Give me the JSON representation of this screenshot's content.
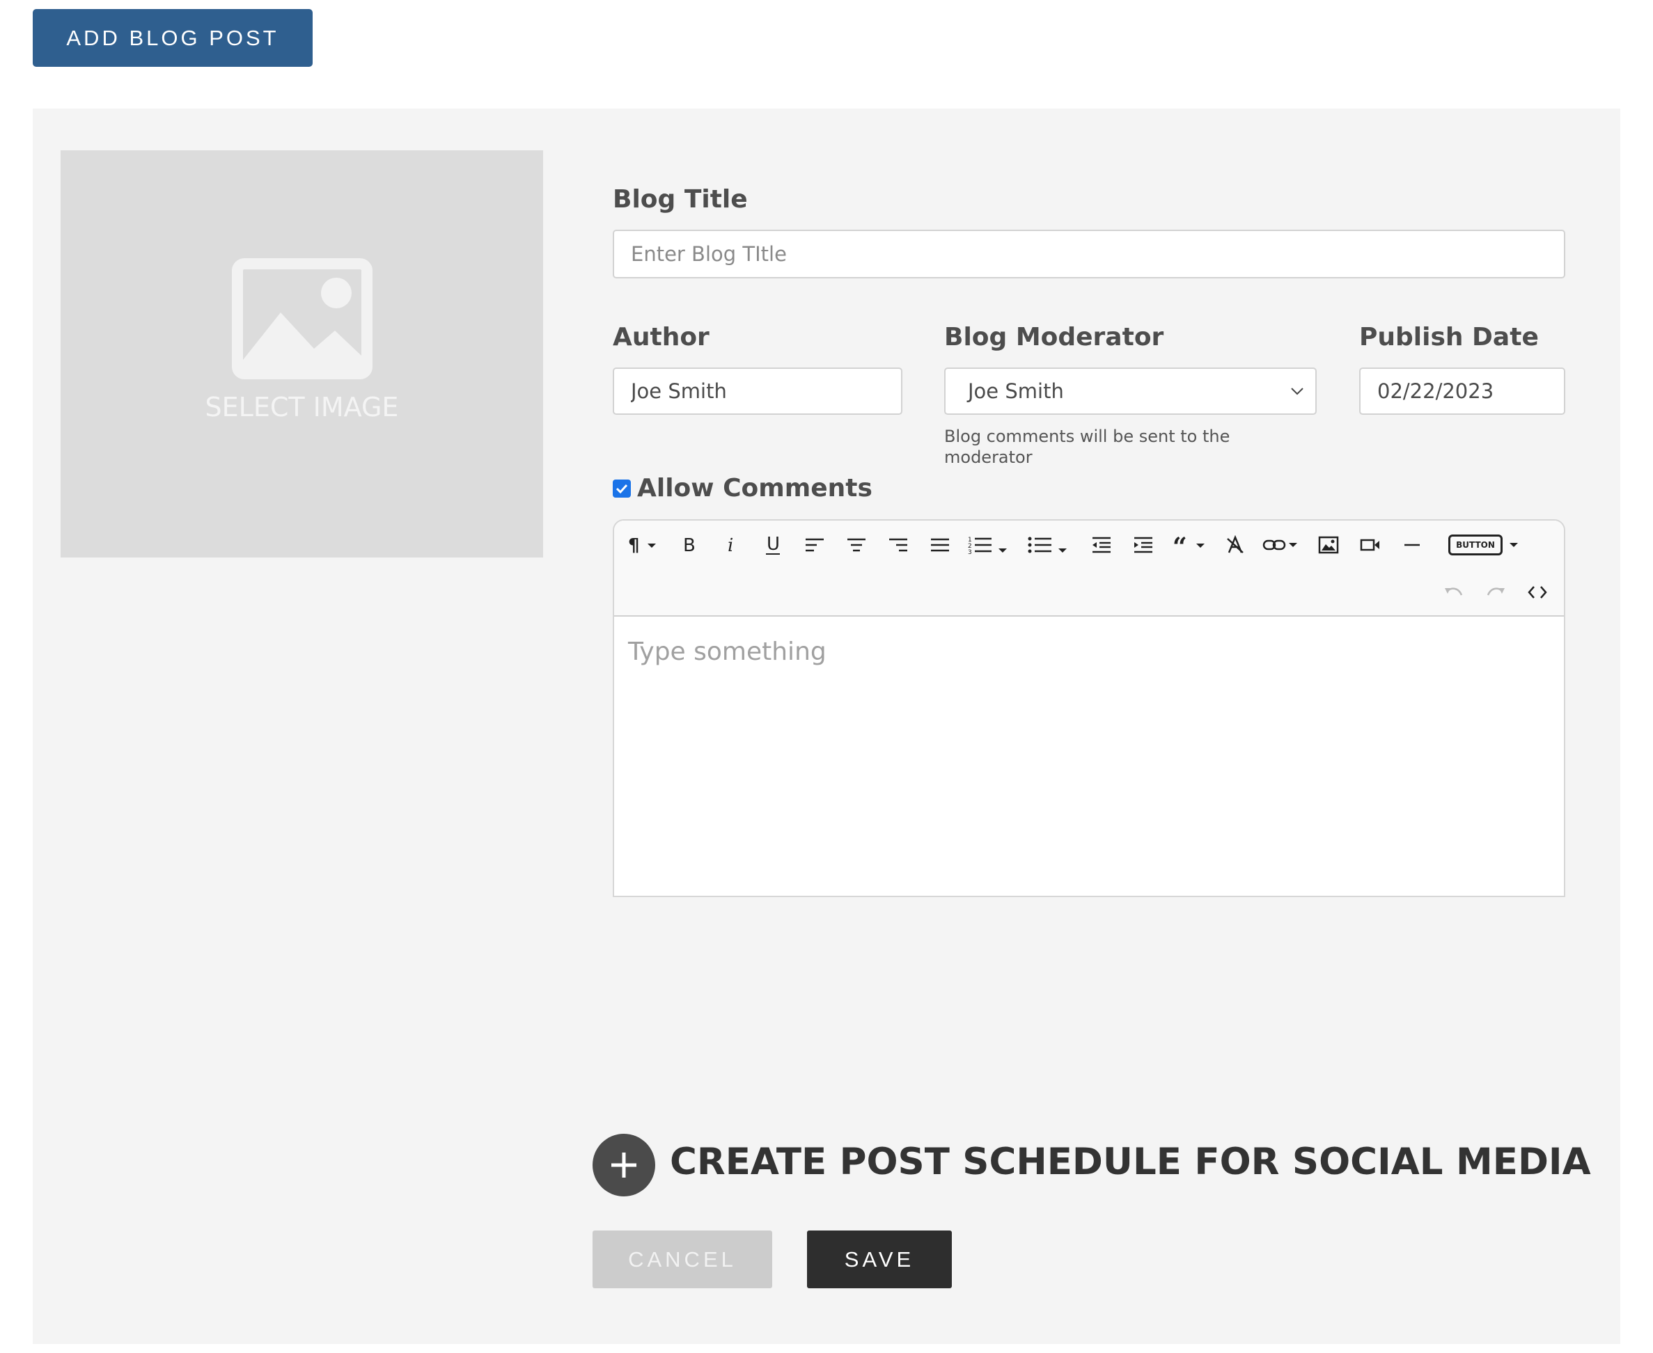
{
  "header": {
    "add_button_label": "ADD BLOG POST"
  },
  "image_picker": {
    "label": "SELECT IMAGE",
    "icon": "image-icon"
  },
  "form": {
    "title_label": "Blog Title",
    "title_placeholder": "Enter Blog TItle",
    "title_value": "",
    "author_label": "Author",
    "author_value": "Joe Smith",
    "moderator_label": "Blog Moderator",
    "moderator_value": "Joe Smith",
    "moderator_hint_line1": "Blog comments will be sent to the",
    "moderator_hint_line2": "moderator",
    "publish_label": "Publish Date",
    "publish_value": "02/22/2023",
    "allow_comments_label": "Allow Comments",
    "allow_comments_checked": true
  },
  "editor": {
    "placeholder": "Type something",
    "toolbar": {
      "insert_button_label": "BUTTON",
      "tools": [
        "paragraph-format",
        "bold",
        "italic",
        "underline",
        "align-left",
        "align-center",
        "align-right",
        "align-justify",
        "ordered-list",
        "unordered-list",
        "outdent",
        "indent",
        "quote",
        "clear-formatting",
        "insert-link",
        "insert-image",
        "insert-video",
        "horizontal-line",
        "insert-button",
        "undo",
        "redo",
        "code-view"
      ]
    }
  },
  "schedule": {
    "label": "CREATE POST SCHEDULE FOR SOCIAL MEDIA"
  },
  "actions": {
    "cancel_label": "CANCEL",
    "save_label": "SAVE"
  },
  "colors": {
    "primary_button": "#2f5f8f",
    "panel_bg": "#f4f4f4",
    "save_button": "#2e2e2e",
    "cancel_button": "#cccccc",
    "checkbox": "#1a73e8"
  }
}
